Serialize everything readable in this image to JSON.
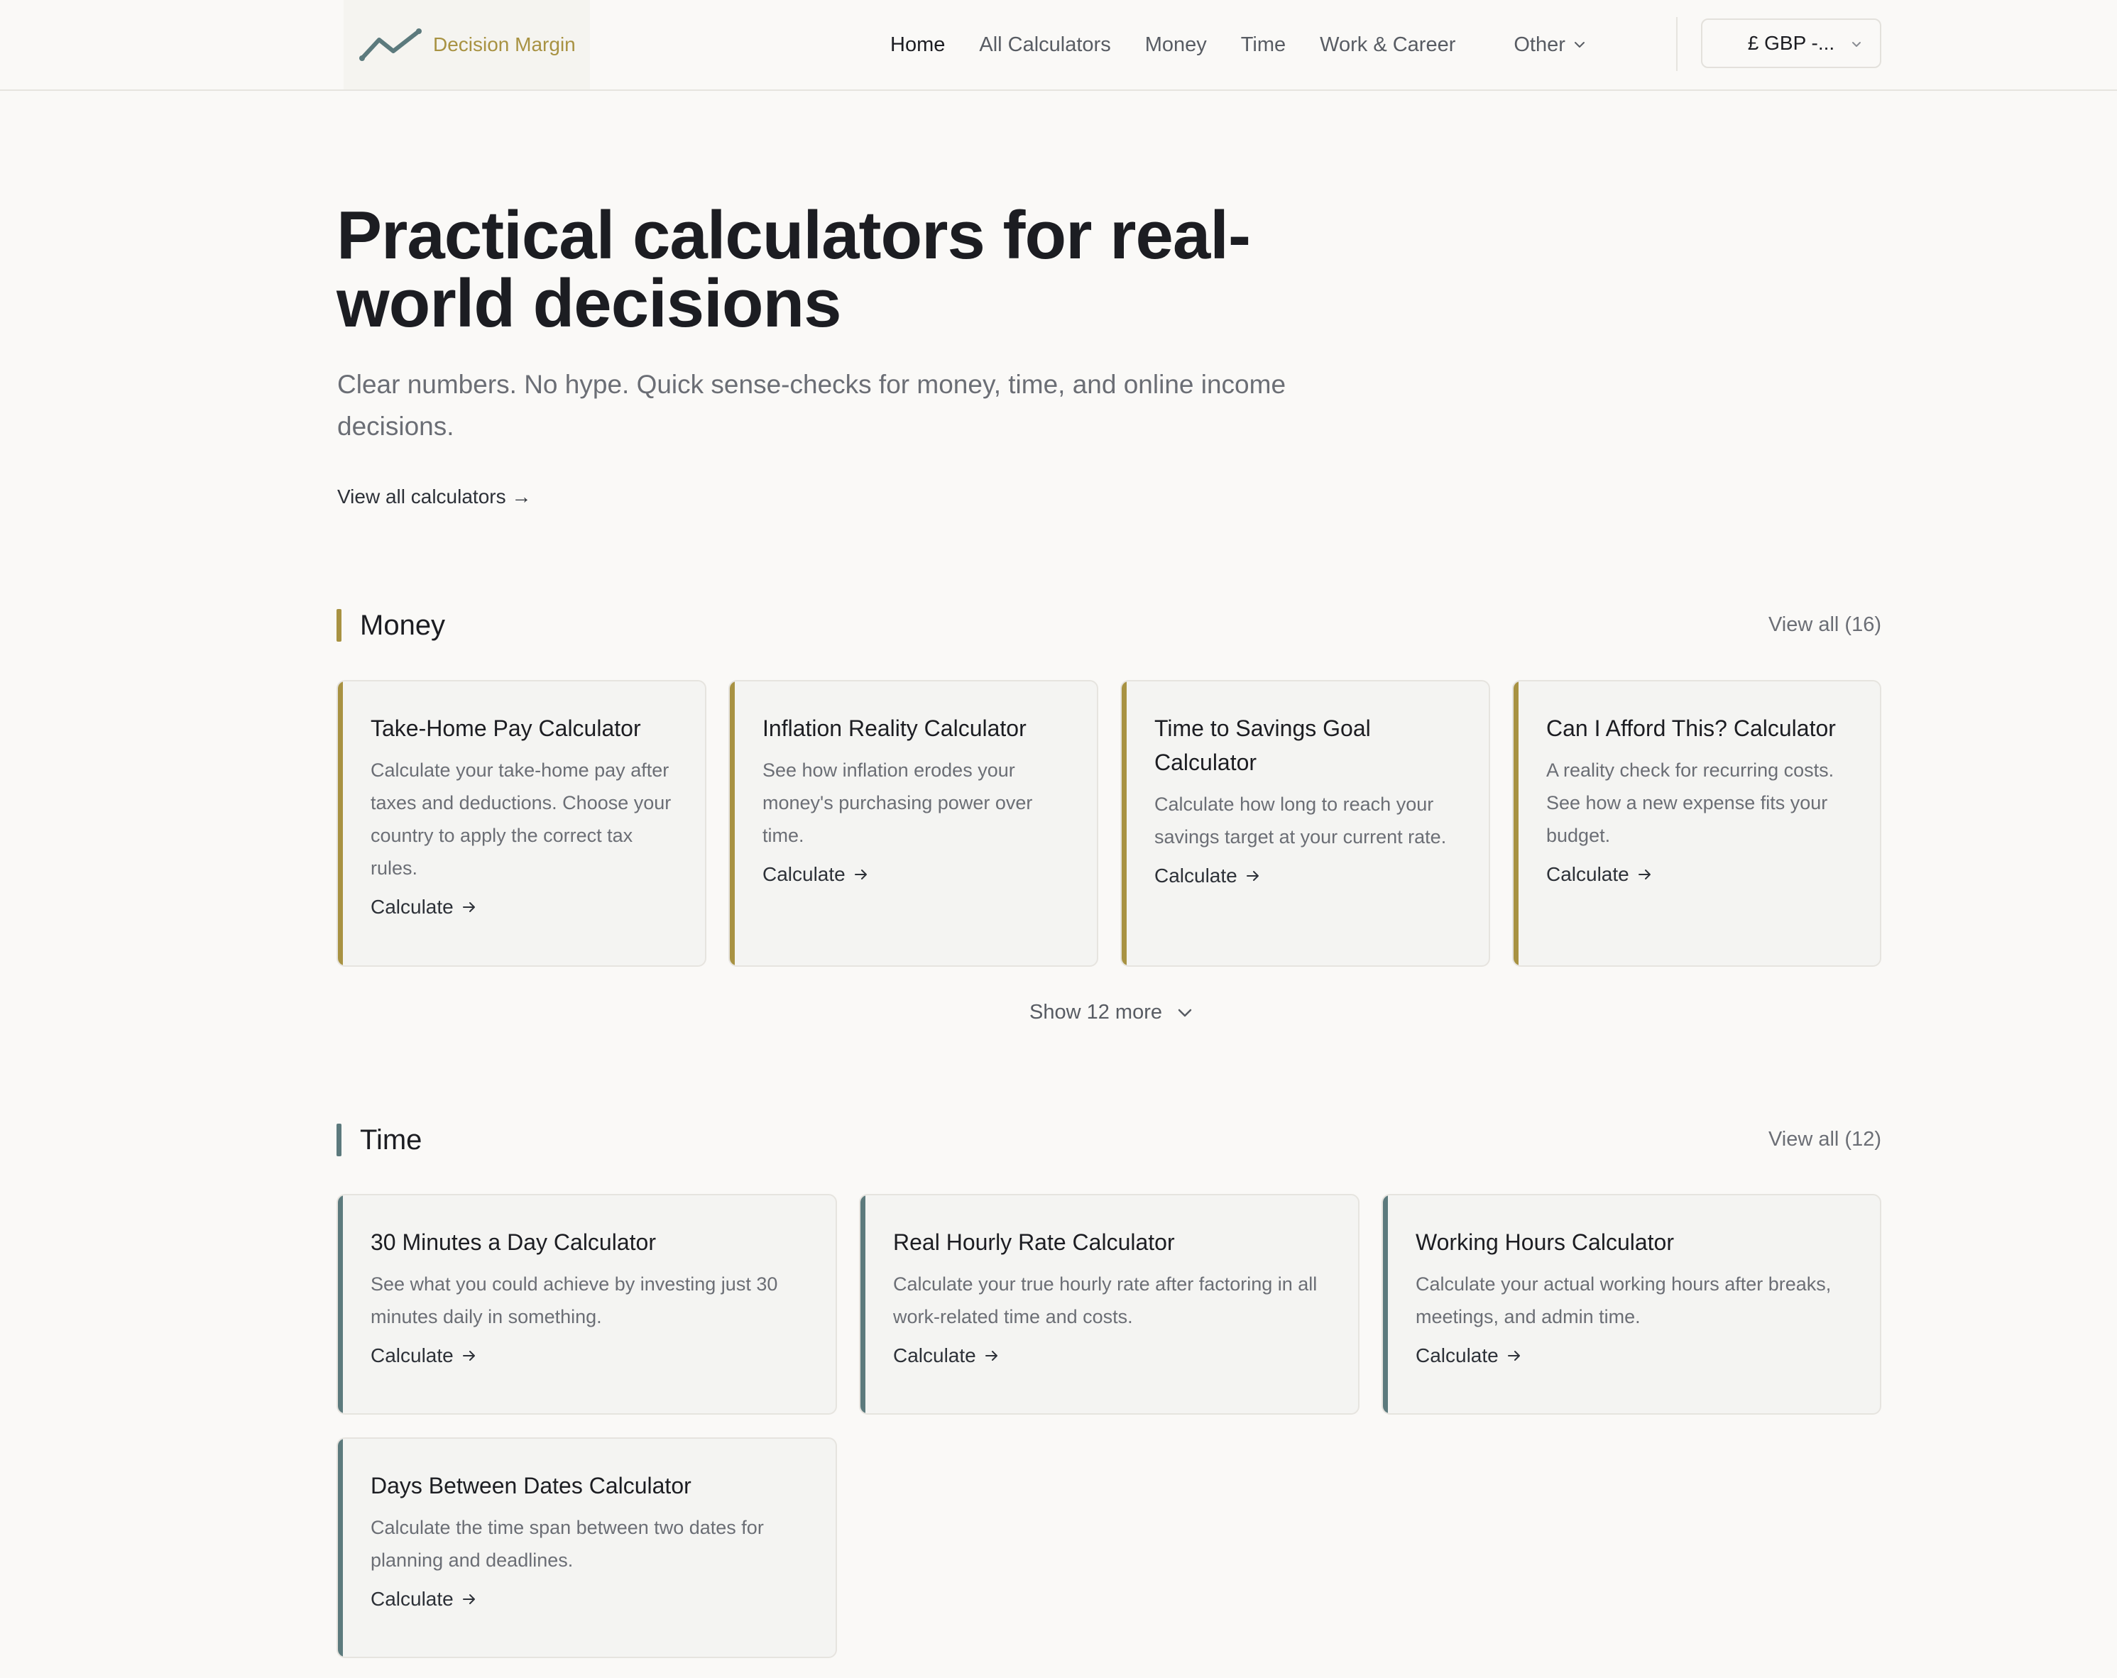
{
  "header": {
    "logo_text": "Decision Margin",
    "nav": [
      {
        "label": "Home",
        "active": true
      },
      {
        "label": "All Calculators"
      },
      {
        "label": "Money"
      },
      {
        "label": "Time"
      },
      {
        "label": "Work & Career"
      },
      {
        "label": "Other"
      }
    ],
    "currency": "£ GBP -..."
  },
  "hero": {
    "title": "Practical calculators for real-world decisions",
    "subtitle": "Clear numbers. No hype. Quick sense-checks for money, time, and online income decisions.",
    "link": "View all calculators"
  },
  "money": {
    "heading": "Money",
    "view_all": "View all (16)",
    "show_more": "Show 12 more",
    "cards": [
      {
        "title": "Take-Home Pay Calculator",
        "desc": "Calculate your take-home pay after taxes and deductions. Choose your country to apply the correct tax rules.",
        "cta": "Calculate"
      },
      {
        "title": "Inflation Reality Calculator",
        "desc": "See how inflation erodes your money's purchasing power over time.",
        "cta": "Calculate"
      },
      {
        "title": "Time to Savings Goal Calculator",
        "desc": "Calculate how long to reach your savings target at your current rate.",
        "cta": "Calculate"
      },
      {
        "title": "Can I Afford This? Calculator",
        "desc": "A reality check for recurring costs. See how a new expense fits your budget.",
        "cta": "Calculate"
      }
    ]
  },
  "time": {
    "heading": "Time",
    "view_all": "View all (12)",
    "cards": [
      {
        "title": "30 Minutes a Day Calculator",
        "desc": "See what you could achieve by investing just 30 minutes daily in something.",
        "cta": "Calculate"
      },
      {
        "title": "Real Hourly Rate Calculator",
        "desc": "Calculate your true hourly rate after factoring in all work-related time and costs.",
        "cta": "Calculate"
      },
      {
        "title": "Working Hours Calculator",
        "desc": "Calculate your actual working hours after breaks, meetings, and admin time.",
        "cta": "Calculate"
      },
      {
        "title": "Days Between Dates Calculator",
        "desc": "Calculate the time span between two dates for planning and deadlines.",
        "cta": "Calculate"
      }
    ]
  },
  "colors": {
    "money_accent": "#a89242",
    "time_accent": "#5c7a7d",
    "background": "#faf9f7",
    "card_background": "#f4f4f2"
  },
  "icons": {
    "logo": "trend-line-icon",
    "nav_dropdown": "chevron-down-icon",
    "link": "arrow-right-icon"
  }
}
